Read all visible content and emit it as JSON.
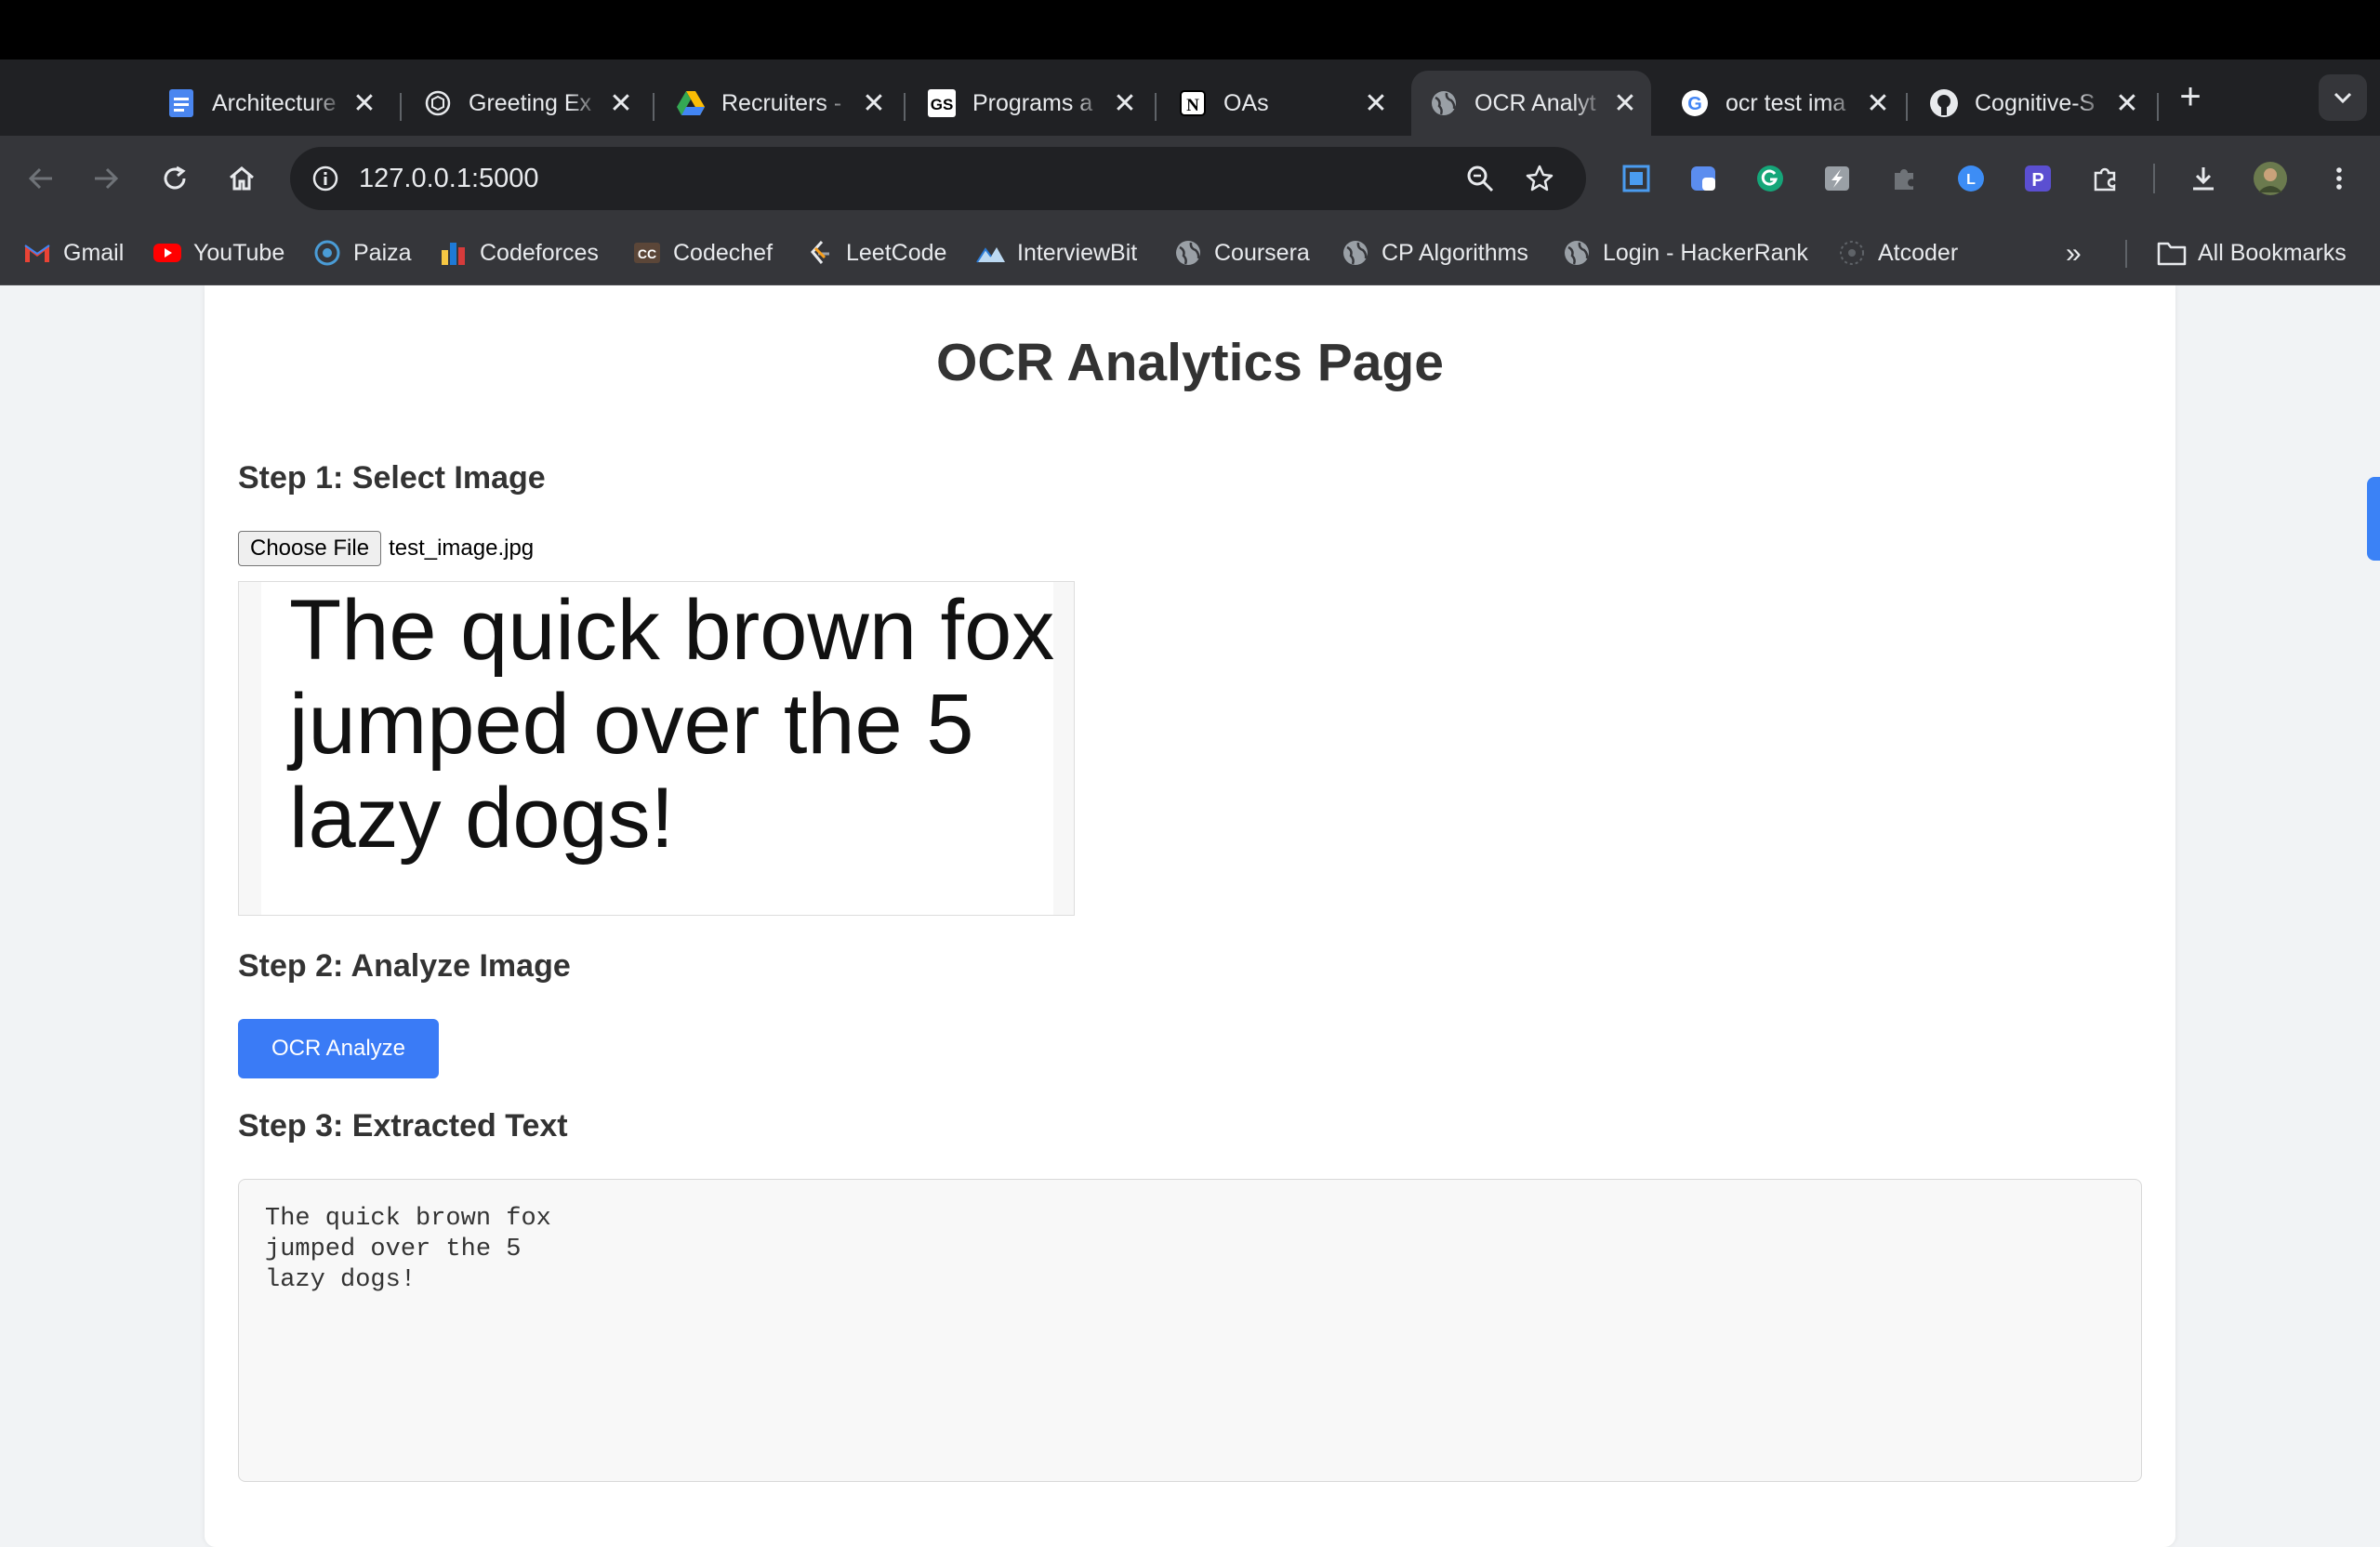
{
  "browser": {
    "tabs": [
      {
        "title": "Architecture",
        "icon": "google-docs-icon",
        "active": false
      },
      {
        "title": "Greeting Ex",
        "icon": "openai-icon",
        "active": false
      },
      {
        "title": "Recruiters -",
        "icon": "google-drive-icon",
        "active": false
      },
      {
        "title": "Programs a",
        "icon": "gs-icon",
        "active": false
      },
      {
        "title": "OAs",
        "icon": "notion-icon",
        "active": false
      },
      {
        "title": "OCR Analyt",
        "icon": "globe-icon",
        "active": true
      },
      {
        "title": "ocr test ima",
        "icon": "google-icon",
        "active": false
      },
      {
        "title": "Cognitive-S",
        "icon": "github-icon",
        "active": false
      }
    ],
    "close_glyph": "✕",
    "new_tab_glyph": "+",
    "url": "127.0.0.1:5000",
    "bookmarks": [
      {
        "label": "Gmail",
        "icon": "gmail-icon"
      },
      {
        "label": "YouTube",
        "icon": "youtube-icon"
      },
      {
        "label": "Paiza",
        "icon": "paiza-icon"
      },
      {
        "label": "Codeforces",
        "icon": "codeforces-icon"
      },
      {
        "label": "Codechef",
        "icon": "codechef-icon"
      },
      {
        "label": "LeetCode",
        "icon": "leetcode-icon"
      },
      {
        "label": "InterviewBit",
        "icon": "interviewbit-icon"
      },
      {
        "label": "Coursera",
        "icon": "globe-icon"
      },
      {
        "label": "CP Algorithms",
        "icon": "globe-icon"
      },
      {
        "label": "Login - HackerRank",
        "icon": "globe-icon"
      },
      {
        "label": "Atcoder",
        "icon": "atcoder-icon"
      }
    ],
    "bookmarks_overflow": "»",
    "all_bookmarks": "All Bookmarks"
  },
  "page": {
    "title": "OCR Analytics Page",
    "step1": "Step 1: Select Image",
    "choose_file": "Choose File",
    "file_name": "test_image.jpg",
    "preview_text": "The quick brown fox\njumped over the 5\nlazy dogs!",
    "step2": "Step 2: Analyze Image",
    "analyze_button": "OCR Analyze",
    "step3": "Step 3: Extracted Text",
    "extracted_text": "The quick brown fox\njumped over the 5\nlazy dogs!"
  },
  "colors": {
    "accent": "#3a7bf6",
    "chrome_dark": "#202124",
    "chrome_toolbar": "#35363a"
  }
}
